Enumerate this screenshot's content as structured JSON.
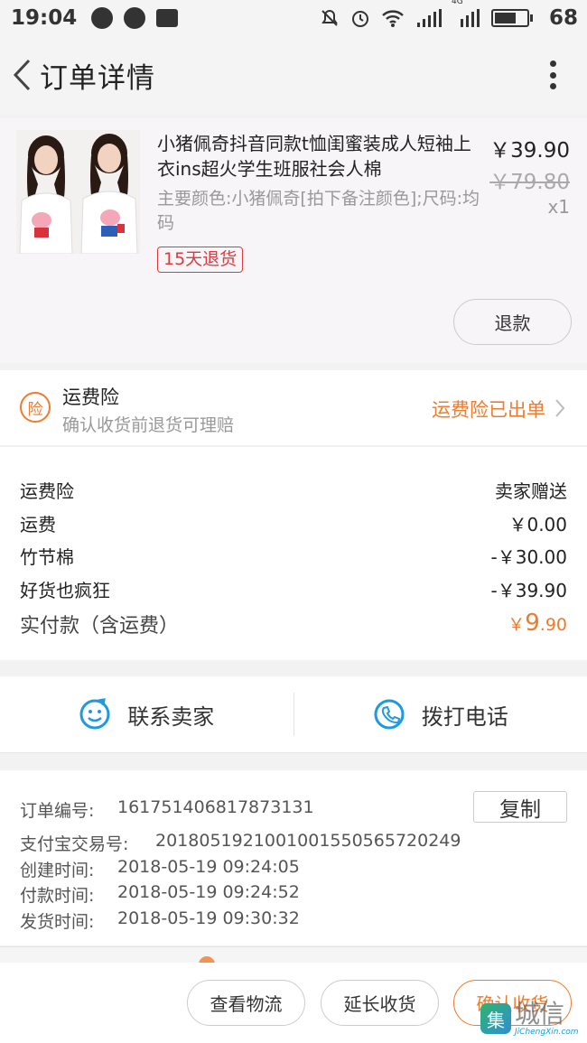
{
  "status_bar": {
    "time": "19:04",
    "network": "4G",
    "battery_percent": "68",
    "battery_level": 0.68
  },
  "header": {
    "title": "订单详情",
    "back_icon": "chevron-left-icon",
    "more_icon": "more-vertical-icon"
  },
  "product": {
    "title": "小猪佩奇抖音同款t恤闺蜜装成人短袖上衣ins超火学生班服社会人棉",
    "sku": "主要颜色:小猪佩奇[拍下备注颜色];尺码:均码",
    "badge": "15天退货",
    "price": "￥39.90",
    "original_price": "￥79.80",
    "quantity": "x1",
    "refund_label": "退款"
  },
  "insurance": {
    "icon_text": "险",
    "title": "运费险",
    "subtitle": "确认收货前退货可理赔",
    "status": "运费险已出单"
  },
  "fees": {
    "rows": [
      {
        "label": "运费险",
        "value": "卖家赠送"
      },
      {
        "label": "运费",
        "value": "￥0.00"
      },
      {
        "label": "竹节棉",
        "value": "-￥30.00"
      },
      {
        "label": "好货也疯狂",
        "value": "-￥39.90"
      }
    ],
    "total_label": "实付款（含运费）",
    "total_symbol": "￥",
    "total_int": "9",
    "total_dec": ".90"
  },
  "contact": {
    "seller_label": "联系卖家",
    "phone_label": "拨打电话"
  },
  "order_info": {
    "order_no_label": "订单编号:",
    "order_no": "161751406817873131",
    "copy_label": "复制",
    "alipay_label": "支付宝交易号:",
    "alipay_no": "2018051921001001550565720249",
    "created_label": "创建时间:",
    "created": "2018-05-19 09:24:05",
    "paid_label": "付款时间:",
    "paid": "2018-05-19 09:24:52",
    "shipped_label": "发货时间:",
    "shipped": "2018-05-19 09:30:32"
  },
  "bottom_bar": {
    "logistics": "查看物流",
    "extend": "延长收货",
    "confirm": "确认收货"
  },
  "watermark": {
    "cn": "城信",
    "en": "JiChengXin.com"
  },
  "colors": {
    "accent": "#f07a2d",
    "badge_red": "#e0393e",
    "contact_blue": "#1e9be0"
  }
}
